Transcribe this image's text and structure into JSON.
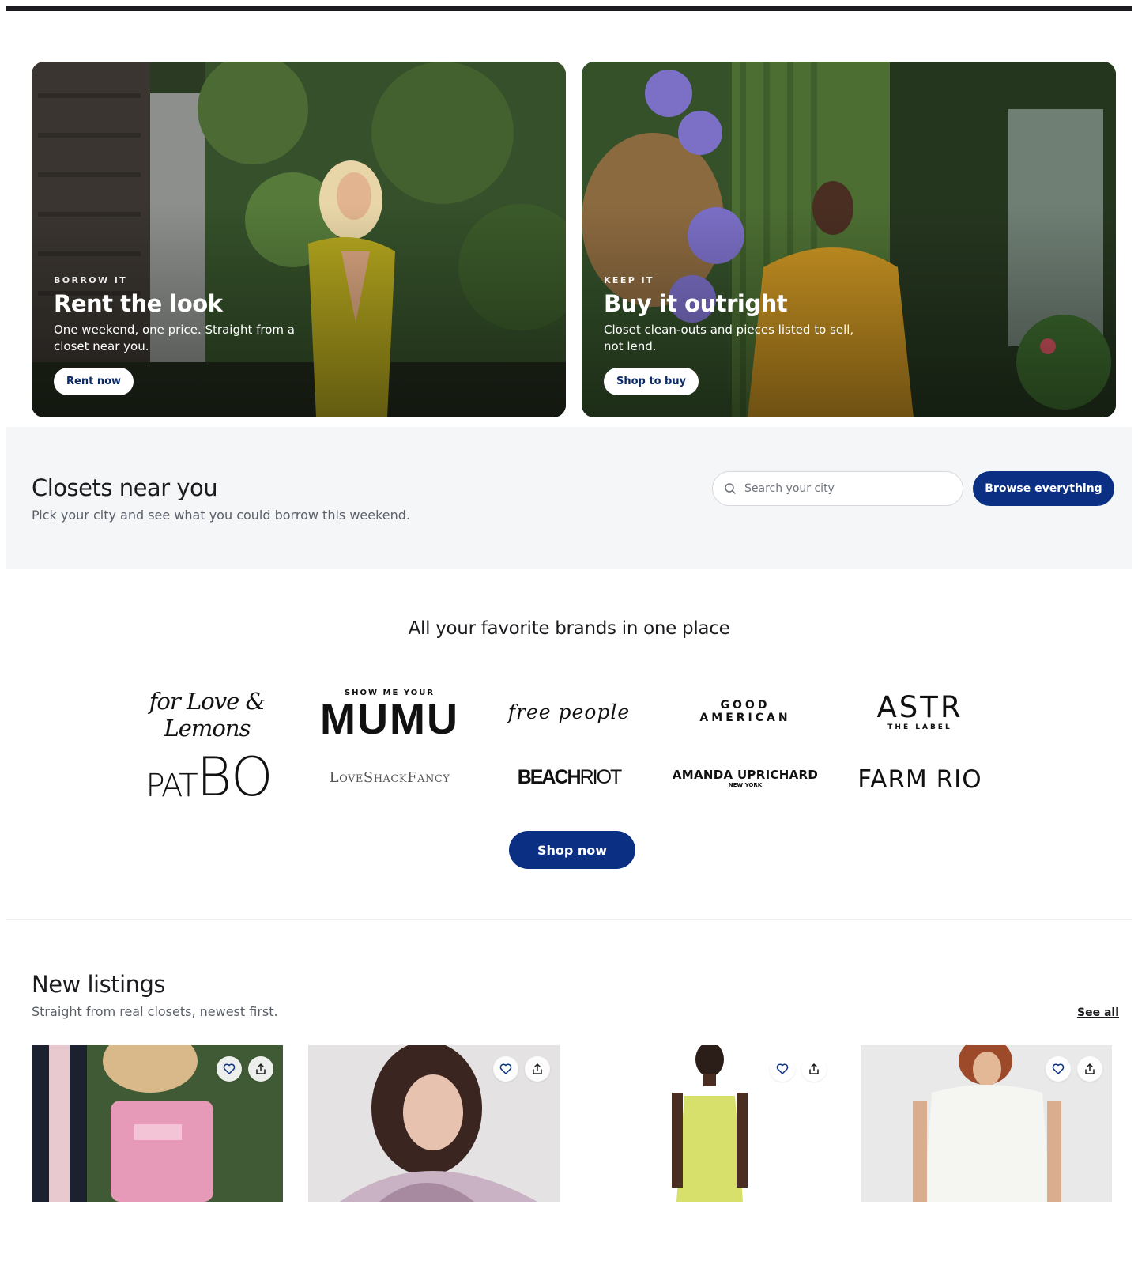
{
  "hero_cards": [
    {
      "eyebrow": "BORROW IT",
      "title": "Rent the look",
      "subtitle": "One weekend, one price. Straight from a closet near you.",
      "cta": "Rent now"
    },
    {
      "eyebrow": "KEEP IT",
      "title": "Buy it outright",
      "subtitle": "Closet clean-outs and pieces listed to sell, not lend.",
      "cta": "Shop to buy"
    }
  ],
  "closets": {
    "title": "Closets near you",
    "subtitle": "Pick your city and see what you could borrow this weekend.",
    "search_placeholder": "Search your city",
    "browse_label": "Browse everything"
  },
  "brands": {
    "heading": "All your favorite brands in one place",
    "logos": {
      "for_love_lemons": "for Love & Lemons",
      "mumu_top": "SHOW ME YOUR",
      "mumu_main": "MUMU",
      "free_people": "free people",
      "good_american": "GOOD AMERICAN",
      "astr_main": "ASTR",
      "astr_sub": "THE LABEL",
      "patbo_pat": "PAT",
      "patbo_bo": "BO",
      "loveshackfancy": "LoveShackFancy",
      "beach": "BEACH",
      "riot": "RIOT",
      "amanda_main": "AMANDA UPRICHARD",
      "amanda_sub": "NEW YORK",
      "farm_rio": "FARM RIO"
    },
    "cta": "Shop now"
  },
  "listings": {
    "title": "New listings",
    "subtitle": "Straight from real closets, newest first.",
    "see_all": "See all"
  },
  "colors": {
    "brand_navy": "#0b2f82",
    "section_bg": "#f5f6f8",
    "text_muted": "#5a5f69"
  },
  "icons": [
    "search-icon",
    "heart-icon",
    "share-icon"
  ]
}
